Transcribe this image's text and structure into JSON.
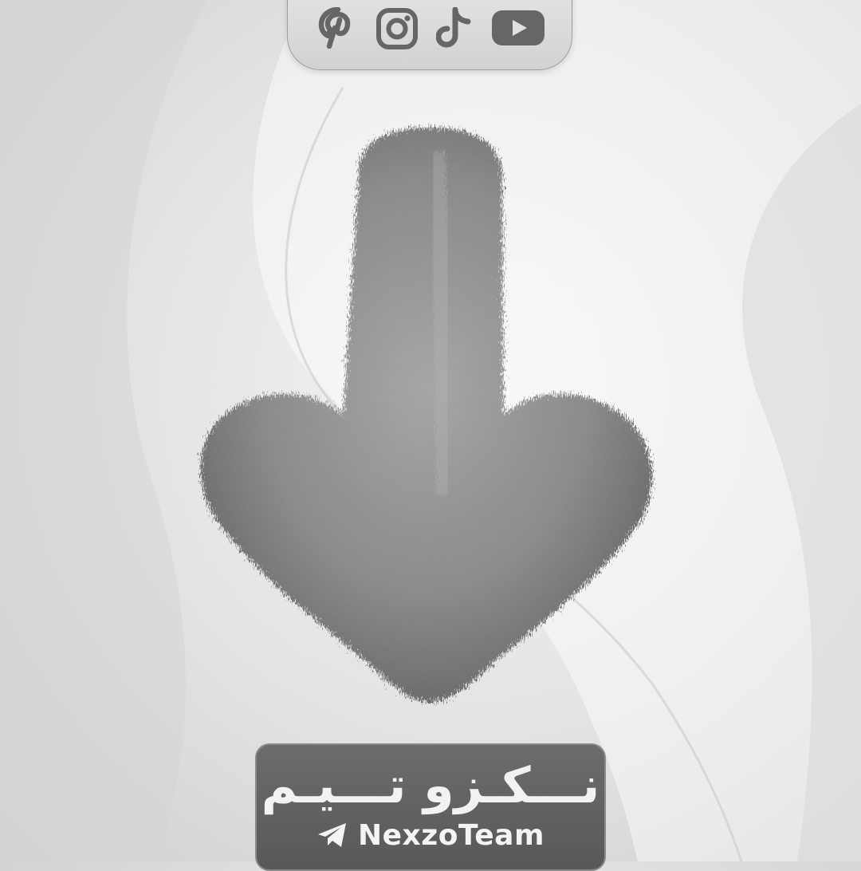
{
  "social": {
    "icons": [
      "pinterest-icon",
      "instagram-icon",
      "tiktok-icon",
      "youtube-icon"
    ],
    "icon_color": "#666666"
  },
  "arrow": {
    "direction": "down",
    "texture": "fur",
    "color": "#8f8f8f"
  },
  "brand": {
    "persian_name": "نـــكـزو تـــيـم",
    "latin_name": "NexzoTeam",
    "icon": "telegram-icon",
    "card_color": "#616161",
    "text_color": "#f4f4f4"
  }
}
